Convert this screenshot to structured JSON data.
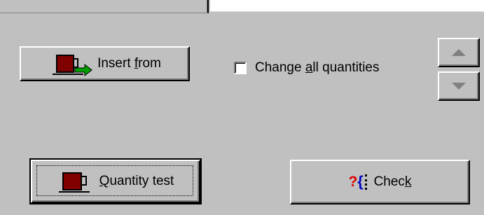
{
  "buttons": {
    "insert_from": {
      "prefix": "Insert ",
      "accel": "f",
      "suffix": "rom"
    },
    "quantity_test": {
      "accel": "Q",
      "suffix": "uantity test"
    },
    "check": {
      "prefix": "Chec",
      "accel": "k",
      "suffix": "",
      "icon_q": "?",
      "icon_brace": "{"
    }
  },
  "options": {
    "change_all_quantities": {
      "prefix": "Change ",
      "accel": "a",
      "suffix": "ll quantities",
      "checked": false
    }
  },
  "icons": {
    "insert_from": "cup-with-green-arrow-icon",
    "quantity_test": "cup-icon",
    "check": "question-brace-icon",
    "up": "arrow-up-icon",
    "down": "arrow-down-icon"
  },
  "colors": {
    "face": "#c0c0c0",
    "cup": "#800000",
    "arrow": "#008000"
  }
}
